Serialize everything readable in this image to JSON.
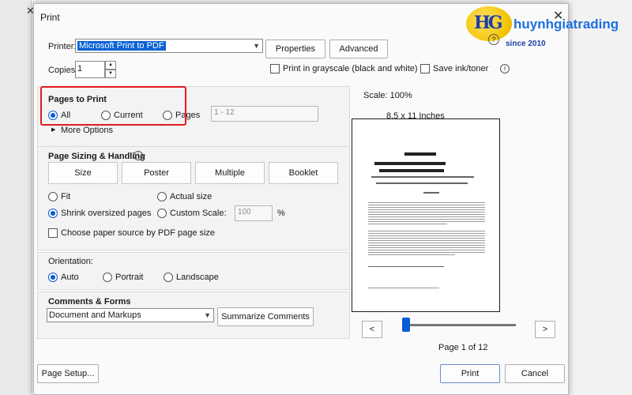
{
  "window": {
    "title": "Print",
    "close_glyph": "✕"
  },
  "logo": {
    "name": "huynhgiatrading",
    "since": "since 2010",
    "badge": "HG"
  },
  "help": {
    "label": "Help",
    "glyph": "?"
  },
  "printer": {
    "label": "Printer:",
    "value": "Microsoft Print to PDF",
    "properties": "Properties",
    "advanced": "Advanced"
  },
  "copies": {
    "label": "Copies:",
    "value": "1"
  },
  "options": {
    "grayscale": "Print in grayscale (black and white)",
    "save_ink": "Save ink/toner"
  },
  "pages_to_print": {
    "title": "Pages to Print",
    "all": "All",
    "current": "Current",
    "pages": "Pages",
    "range_placeholder": "1 - 12",
    "more": "More Options",
    "selected": "all"
  },
  "sizing": {
    "title": "Page Sizing & Handling",
    "tabs": [
      "Size",
      "Poster",
      "Multiple",
      "Booklet"
    ],
    "fit": "Fit",
    "actual": "Actual size",
    "shrink": "Shrink oversized pages",
    "custom": "Custom Scale:",
    "custom_value": "100",
    "percent": "%",
    "choose_source": "Choose paper source by PDF page size",
    "selected": "shrink"
  },
  "orientation": {
    "title": "Orientation:",
    "auto": "Auto",
    "portrait": "Portrait",
    "landscape": "Landscape",
    "selected": "auto"
  },
  "comments": {
    "title": "Comments & Forms",
    "value": "Document and Markups",
    "summarize": "Summarize Comments"
  },
  "preview": {
    "scale": "Scale: 100%",
    "size": "8.5 x 11 Inches",
    "page_text": "Page 1 of 12",
    "prev": "<",
    "next": ">",
    "position": 0.02
  },
  "footer": {
    "page_setup": "Page Setup...",
    "print": "Print",
    "cancel": "Cancel"
  },
  "colors": {
    "accent": "#0a5bd6",
    "highlight": "#e21b1b"
  }
}
